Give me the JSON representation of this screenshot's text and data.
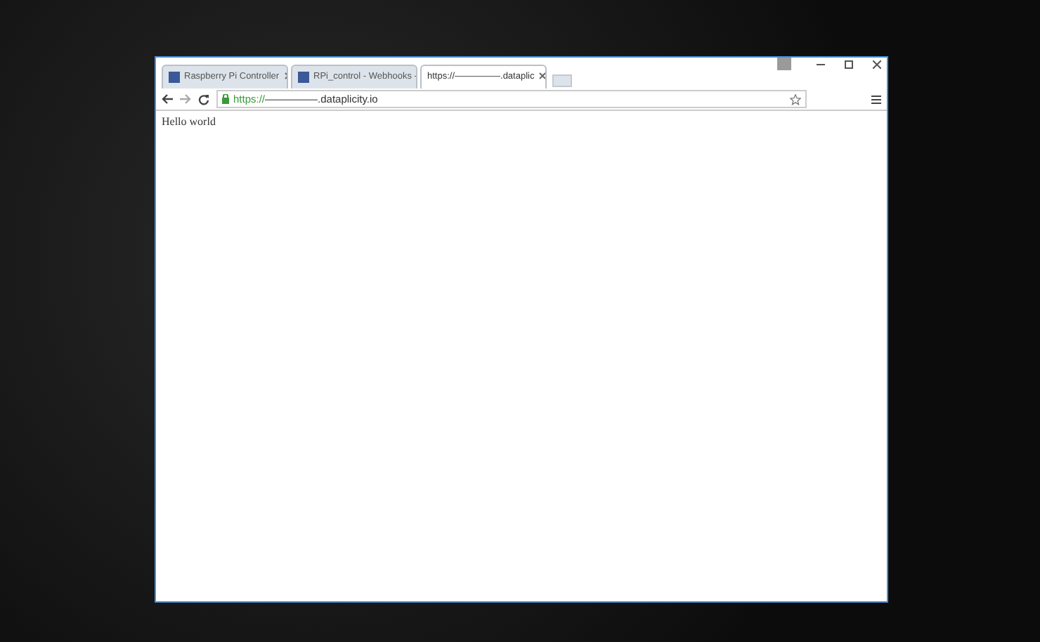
{
  "window": {
    "tabs": [
      {
        "label": "Raspberry Pi Controller",
        "selected": false,
        "favicon": true
      },
      {
        "label": "RPi_control - Webhooks -",
        "selected": false,
        "favicon": true
      },
      {
        "label": "https://—————.dataplic",
        "selected": true,
        "favicon": false
      }
    ],
    "address_bar": {
      "scheme": "https://",
      "rest": "—————.dataplicity.io",
      "secure": true
    },
    "page": {
      "text": "Hello world"
    }
  }
}
